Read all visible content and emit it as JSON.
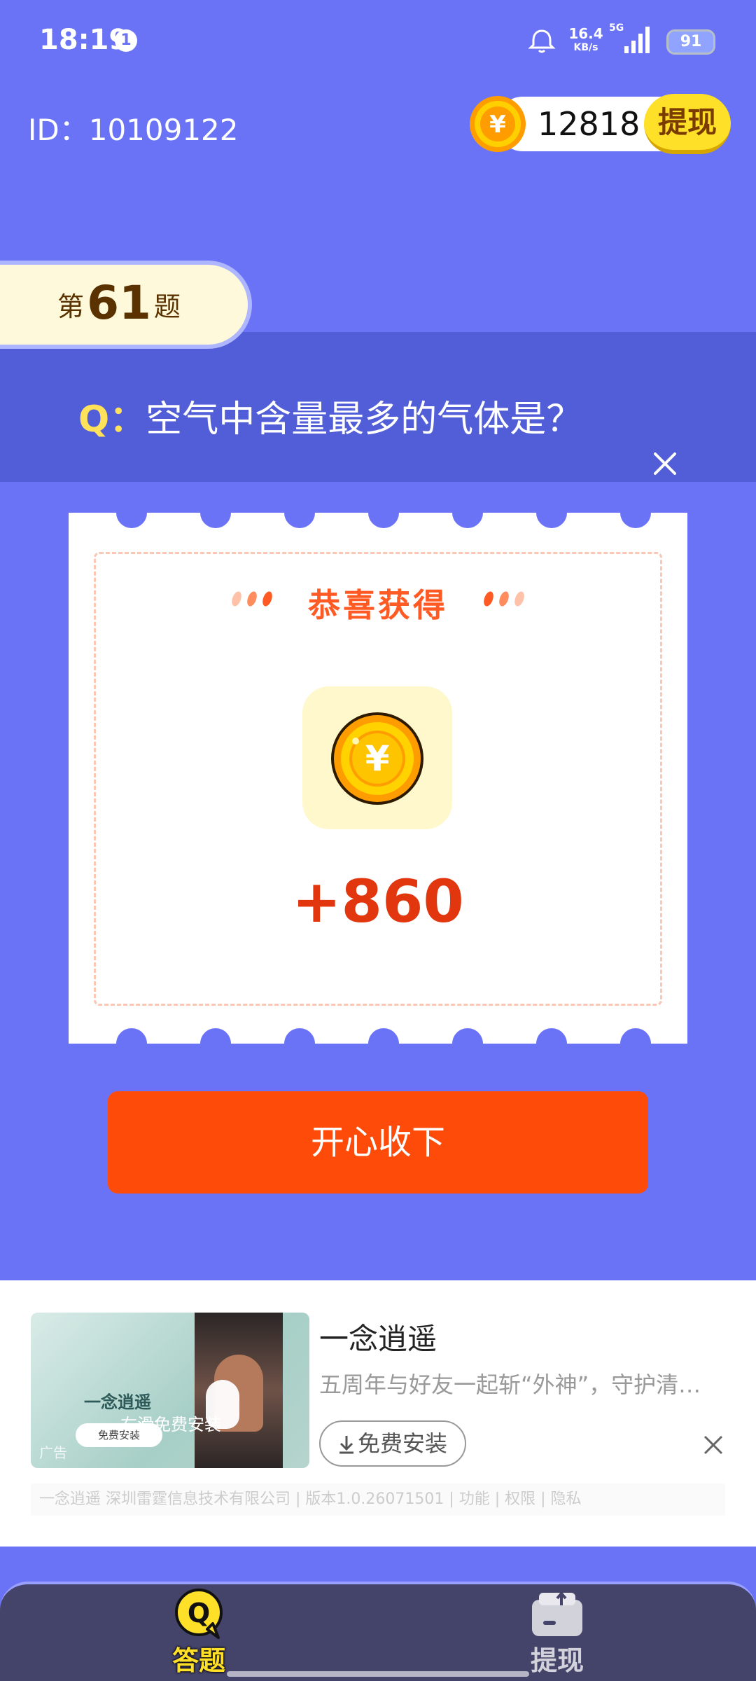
{
  "status_bar": {
    "time": "18:19",
    "notification_count": "1",
    "net_speed_value": "16.4",
    "net_speed_unit": "KB/s",
    "network": "5G",
    "battery": "91"
  },
  "header": {
    "user_id": "ID：10109122",
    "coin_balance": "12818",
    "withdraw_label": "提现",
    "coin_symbol": "¥"
  },
  "question": {
    "num_prefix": "第",
    "number": "61",
    "num_suffix": "题",
    "q_prefix": "Q：",
    "text": "空气中含量最多的气体是？"
  },
  "reward_modal": {
    "title": "恭喜获得",
    "coin_symbol": "¥",
    "amount": "+860",
    "accept_label": "开心收下"
  },
  "ad": {
    "app_name": "一念逍遥",
    "description": "五周年与好友一起斩“外神”，守护清…",
    "install_label": "免费安装",
    "thumb_title": "一念逍遥",
    "thumb_slide_text": "右滑免费安装",
    "thumb_install_chip": "免费安装",
    "thumb_ad_mark": "广告",
    "meta": "一念逍遥  深圳雷霆信息技术有限公司 | 版本1.0.26071501 | 功能 | 权限 | 隐私"
  },
  "nav": {
    "items": [
      {
        "label": "答题",
        "icon": "q-bubble-icon",
        "active": true
      },
      {
        "label": "提现",
        "icon": "wallet-icon",
        "active": false
      }
    ]
  },
  "colors": {
    "background": "#6a72f6",
    "banner": "#525dd8",
    "accent_orange": "#ff4b0a",
    "coin_yellow": "#ffe029"
  }
}
